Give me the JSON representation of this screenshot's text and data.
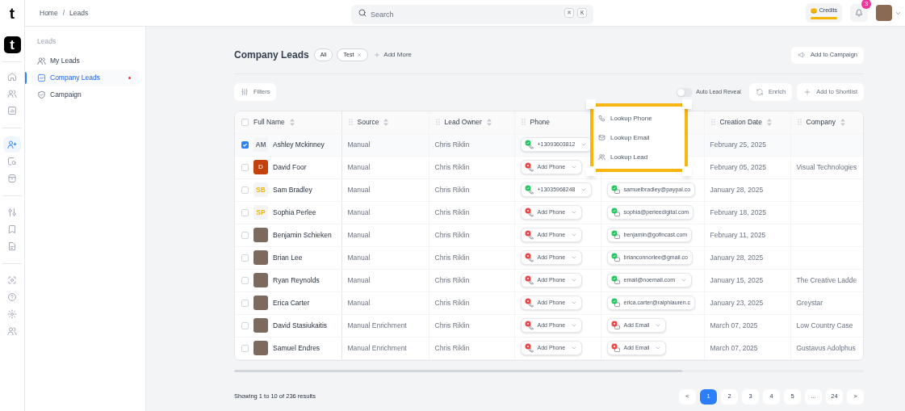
{
  "rail": {
    "logo": "t",
    "app_icon": "t",
    "groups": [
      [
        {
          "selected": false
        },
        {
          "selected": false
        },
        {
          "selected": false
        }
      ],
      [
        {
          "selected": true
        },
        {
          "selected": false
        },
        {
          "selected": false
        }
      ],
      [
        {
          "selected": false
        },
        {
          "selected": false
        },
        {
          "selected": false
        }
      ],
      [
        {
          "selected": false
        },
        {
          "selected": false
        },
        {
          "selected": false
        },
        {
          "selected": false
        }
      ]
    ]
  },
  "topbar": {
    "breadcrumb": [
      "Home",
      "Leads"
    ],
    "separator": "/",
    "search": {
      "placeholder": "Search",
      "shortcut": [
        "⌘",
        "K"
      ]
    },
    "credits": "Credits",
    "notifications": "3"
  },
  "sidebar": {
    "section": "Leads",
    "items": [
      {
        "label": "My Leads",
        "selected": false,
        "dot": false
      },
      {
        "label": "Company Leads",
        "selected": true,
        "dot": true
      },
      {
        "label": "Campaign",
        "selected": false,
        "dot": false
      }
    ]
  },
  "header": {
    "title": "Company Leads",
    "chips": [
      {
        "label": "All",
        "removable": false
      },
      {
        "label": "Test",
        "removable": true
      }
    ],
    "add_more": "Add More",
    "campaign_button": "Add to Campaign"
  },
  "toolbar": {
    "filters": "Filters",
    "auto_reveal": {
      "label": "Auto Lead Reveal",
      "on": false
    },
    "enrich": "Enrich",
    "shortlist": "Add to Shortlist"
  },
  "table": {
    "all_selected": false,
    "columns": [
      {
        "kind": "name",
        "label": "Full Name",
        "sortable": true
      },
      {
        "kind": "text",
        "label": "Source",
        "sortable": true
      },
      {
        "kind": "text",
        "label": "Lead Owner",
        "sortable": true
      },
      {
        "kind": "phone",
        "label": "Phone",
        "sortable": false
      },
      {
        "kind": "email"
      },
      {
        "kind": "text",
        "label": "Creation Date",
        "sortable": true
      },
      {
        "kind": "text",
        "label": "Company",
        "sortable": true
      }
    ],
    "rows": [
      {
        "selected": true,
        "name": "Ashley Mckinney",
        "avatar": {
          "kind": "initials-soft",
          "text": "AM",
          "color": "#6b7280"
        },
        "source": "Manual",
        "owner": "Chris Riklin",
        "phone": {
          "kind": "found",
          "text": "+13093603812"
        },
        "date": "February 25, 2025"
      },
      {
        "selected": false,
        "name": "David Foor",
        "avatar": {
          "kind": "initials-filled",
          "text": "D",
          "color": "#c2410c"
        },
        "source": "Manual",
        "owner": "Chris Riklin",
        "phone": {
          "kind": "missing",
          "text": "Add Phone"
        },
        "date": "February 05, 2025",
        "company": "Visual Technologies"
      },
      {
        "selected": false,
        "name": "Sam Bradley",
        "avatar": {
          "kind": "initials-soft",
          "text": "SB",
          "color": "#f5b400"
        },
        "source": "Manual",
        "owner": "Chris Riklin",
        "phone": {
          "kind": "found",
          "text": "+13035968248"
        },
        "email": {
          "kind": "found",
          "text": "samuelbradley@paypal.co",
          "caret": false
        },
        "date": "January 28, 2025"
      },
      {
        "selected": false,
        "name": "Sophia Perlee",
        "avatar": {
          "kind": "initials-soft",
          "text": "SP",
          "color": "#f5b400"
        },
        "source": "Manual",
        "owner": "Chris Riklin",
        "phone": {
          "kind": "missing",
          "text": "Add Phone"
        },
        "email": {
          "kind": "found",
          "text": "sophia@perleedigital.com",
          "caret": false
        },
        "date": "February 18, 2025"
      },
      {
        "selected": false,
        "name": "Benjamin Schieken",
        "avatar": {
          "kind": "photo"
        },
        "source": "Manual",
        "owner": "Chris Riklin",
        "phone": {
          "kind": "missing",
          "text": "Add Phone"
        },
        "email": {
          "kind": "found",
          "text": "benjamin@gofincast.com",
          "caret": false
        },
        "date": "February 11, 2025"
      },
      {
        "selected": false,
        "name": "Brian Lee",
        "avatar": {
          "kind": "photo"
        },
        "source": "Manual",
        "owner": "Chris Riklin",
        "phone": {
          "kind": "missing",
          "text": "Add Phone"
        },
        "email": {
          "kind": "found",
          "text": "brianconnorlee@gmail.co",
          "caret": false
        },
        "date": "January 28, 2025"
      },
      {
        "selected": false,
        "name": "Ryan Reynolds",
        "avatar": {
          "kind": "photo"
        },
        "source": "Manual",
        "owner": "Chris Riklin",
        "phone": {
          "kind": "missing",
          "text": "Add Phone"
        },
        "email": {
          "kind": "found",
          "text": "email@noemail.com",
          "caret": true
        },
        "date": "January 15, 2025",
        "company": "The Creative Ladde"
      },
      {
        "selected": false,
        "name": "Erica Carter",
        "avatar": {
          "kind": "photo"
        },
        "source": "Manual",
        "owner": "Chris Riklin",
        "phone": {
          "kind": "missing",
          "text": "Add Phone"
        },
        "email": {
          "kind": "found",
          "text": "erica.carter@ralphlauren.c",
          "caret": false
        },
        "date": "January 23, 2025",
        "company": "Greystar"
      },
      {
        "selected": false,
        "name": "David Stasiukaitis",
        "avatar": {
          "kind": "photo"
        },
        "source": "Manual Enrichment",
        "owner": "Chris Riklin",
        "phone": {
          "kind": "missing",
          "text": "Add Phone"
        },
        "email": {
          "kind": "missing",
          "text": "Add Email",
          "caret": true
        },
        "date": "March 07, 2025",
        "company": "Low Country Case"
      },
      {
        "selected": false,
        "name": "Samuel Endres",
        "avatar": {
          "kind": "photo"
        },
        "source": "Manual Enrichment",
        "owner": "Chris Riklin",
        "phone": {
          "kind": "missing",
          "text": "Add Phone"
        },
        "email": {
          "kind": "missing",
          "text": "Add Email",
          "caret": true
        },
        "date": "March 07, 2025",
        "company": "Gustavus Adolphus"
      }
    ]
  },
  "lookup_menu": {
    "items": [
      {
        "label": "Lookup Phone"
      },
      {
        "label": "Lookup Email"
      },
      {
        "label": "Lookup Lead"
      }
    ]
  },
  "footer": {
    "summary": "Showing 1 to 10 of 236 results",
    "pages": [
      {
        "label": "<",
        "selected": false
      },
      {
        "label": "1",
        "selected": true
      },
      {
        "label": "2",
        "selected": false
      },
      {
        "label": "3",
        "selected": false
      },
      {
        "label": "4",
        "selected": false
      },
      {
        "label": "5",
        "selected": false
      },
      {
        "label": "...",
        "selected": false
      },
      {
        "label": "24",
        "selected": false
      },
      {
        "label": ">",
        "selected": false
      }
    ]
  }
}
